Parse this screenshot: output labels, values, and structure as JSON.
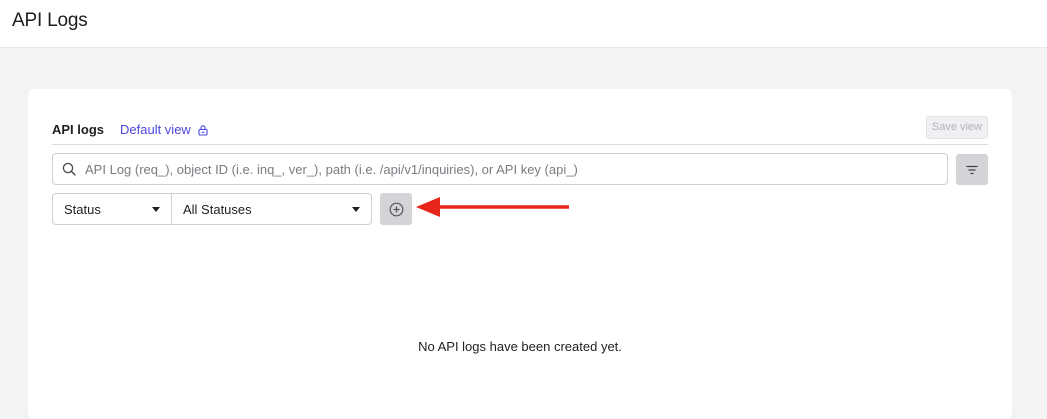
{
  "header": {
    "title": "API Logs"
  },
  "tabs": {
    "api_logs": "API logs",
    "default_view": "Default view",
    "save_view": "Save view"
  },
  "search": {
    "placeholder": "API Log (req_), object ID (i.e. inq_, ver_), path (i.e. /api/v1/inquiries), or API key (api_)"
  },
  "filters": {
    "field_value": "Status",
    "status_value": "All Statuses"
  },
  "empty_state": {
    "message": "No API logs have been created yet."
  },
  "icons": {
    "lock": "lock-icon",
    "search": "search-icon",
    "filter": "filter-icon",
    "add": "add-circle-icon",
    "annotation": "red-arrow"
  },
  "colors": {
    "accent": "#4a45e0",
    "annotation_arrow": "#e8251a"
  }
}
